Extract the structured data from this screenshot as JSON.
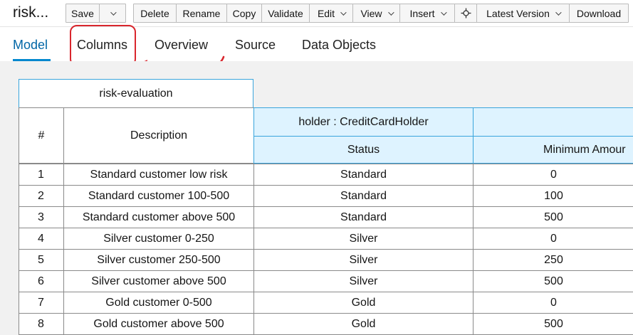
{
  "toolbar": {
    "title": "risk...",
    "buttons": {
      "save": "Save",
      "delete": "Delete",
      "rename": "Rename",
      "copy": "Copy",
      "validate": "Validate",
      "edit": "Edit",
      "view": "View",
      "insert": "Insert",
      "latest_version": "Latest Version",
      "download": "Download"
    }
  },
  "tabs": [
    "Model",
    "Columns",
    "Overview",
    "Source",
    "Data Objects"
  ],
  "active_tab": "Model",
  "highlighted_tab": "Columns",
  "annotation_color": "#d9262d",
  "accent_color": "#0088ce",
  "table": {
    "name": "risk-evaluation",
    "headers": {
      "number": "#",
      "description": "Description",
      "pattern": "holder : CreditCardHolder",
      "status": "Status",
      "minimum_amount": "Minimum Amour"
    },
    "rows": [
      {
        "num": "1",
        "description": "Standard customer low risk",
        "status": "Standard",
        "min": "0"
      },
      {
        "num": "2",
        "description": "Standard customer 100-500",
        "status": "Standard",
        "min": "100"
      },
      {
        "num": "3",
        "description": "Standard customer above 500",
        "status": "Standard",
        "min": "500"
      },
      {
        "num": "4",
        "description": "Silver customer 0-250",
        "status": "Silver",
        "min": "0"
      },
      {
        "num": "5",
        "description": "Silver customer 250-500",
        "status": "Silver",
        "min": "250"
      },
      {
        "num": "6",
        "description": "Silver customer above 500",
        "status": "Silver",
        "min": "500"
      },
      {
        "num": "7",
        "description": "Gold customer 0-500",
        "status": "Gold",
        "min": "0"
      },
      {
        "num": "8",
        "description": "Gold customer above 500",
        "status": "Gold",
        "min": "500"
      }
    ]
  }
}
